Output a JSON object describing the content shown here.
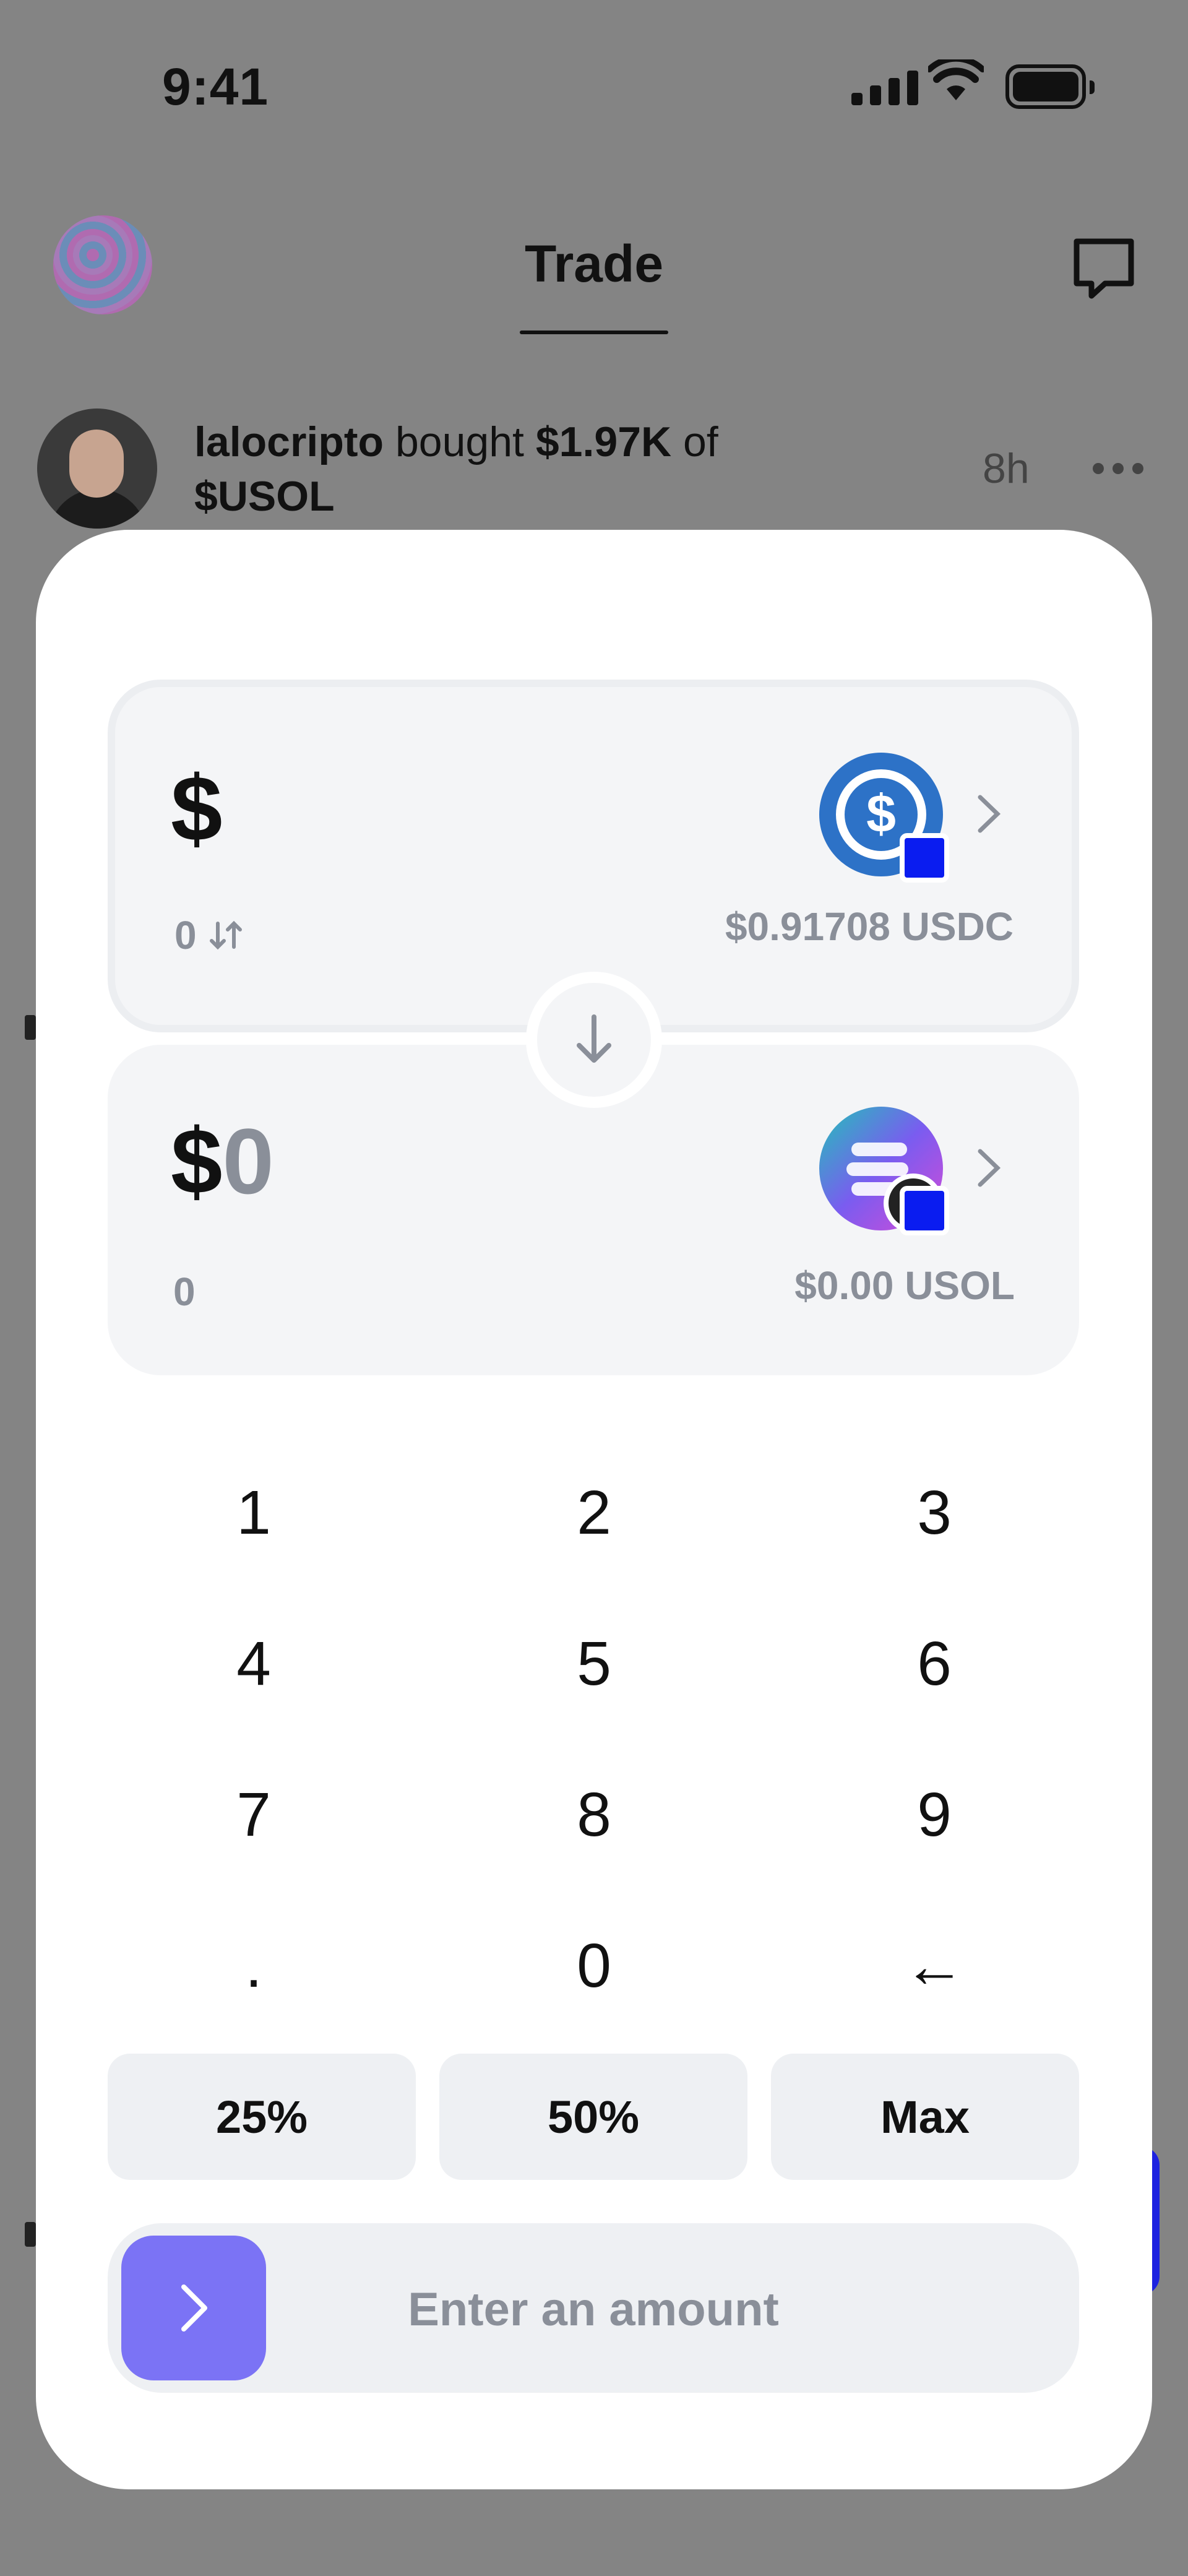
{
  "status_bar": {
    "time": "9:41"
  },
  "header": {
    "title": "Trade"
  },
  "feed_item": {
    "user": "lalocripto",
    "verb": "bought",
    "amount": "$1.97K",
    "preposition": "of",
    "token": "$USOL",
    "time_ago": "8h"
  },
  "swap": {
    "from": {
      "currency_symbol": "$",
      "token_amount": "0",
      "balance": "$0.91708 USDC",
      "token_icon": "usdc-icon"
    },
    "to": {
      "currency_symbol": "$",
      "amount": "0",
      "token_amount": "0",
      "balance": "$0.00 USOL",
      "token_icon": "usol-icon"
    }
  },
  "keypad": {
    "keys": [
      "1",
      "2",
      "3",
      "4",
      "5",
      "6",
      "7",
      "8",
      "9",
      ".",
      "0",
      "←"
    ]
  },
  "presets": [
    "25%",
    "50%",
    "Max"
  ],
  "submit": {
    "label": "Enter an amount"
  },
  "colors": {
    "accent": "#7b73f5",
    "usdc": "#2d72c7",
    "badge": "#0a1cf0"
  }
}
